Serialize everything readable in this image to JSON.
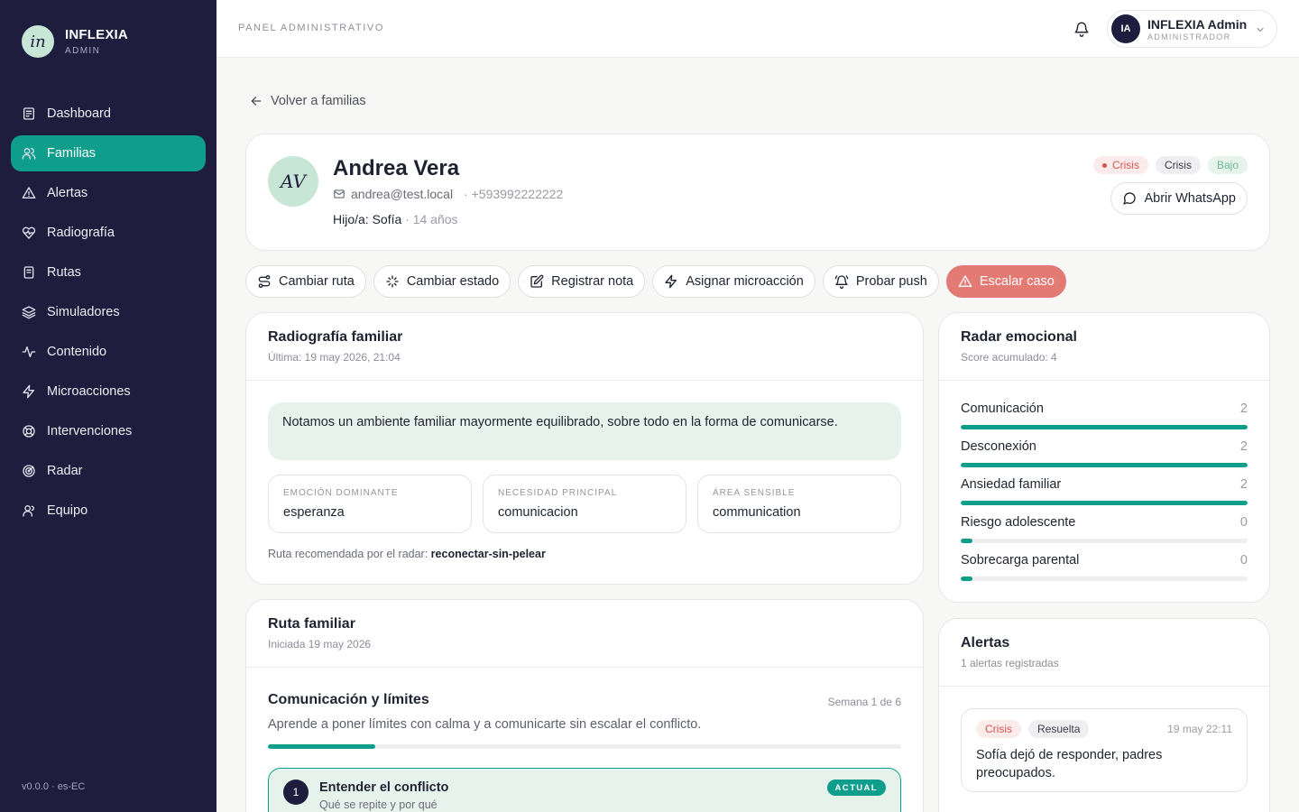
{
  "brand": {
    "logo": "in",
    "name": "INFLEXIA",
    "sub": "ADMIN"
  },
  "sidebar": {
    "items": [
      {
        "label": "Dashboard",
        "icon": "dashboard-icon"
      },
      {
        "label": "Familias",
        "icon": "users-icon",
        "active": true
      },
      {
        "label": "Alertas",
        "icon": "alert-triangle-icon"
      },
      {
        "label": "Radiografía",
        "icon": "heart-pulse-icon"
      },
      {
        "label": "Rutas",
        "icon": "book-icon"
      },
      {
        "label": "Simuladores",
        "icon": "layers-icon"
      },
      {
        "label": "Contenido",
        "icon": "activity-icon"
      },
      {
        "label": "Microacciones",
        "icon": "zap-icon"
      },
      {
        "label": "Intervenciones",
        "icon": "lifebuoy-icon"
      },
      {
        "label": "Radar",
        "icon": "radar-icon"
      },
      {
        "label": "Equipo",
        "icon": "user-group-icon"
      }
    ],
    "version": "v0.0.0 · es-EC"
  },
  "topbar": {
    "title": "PANEL ADMINISTRATIVO",
    "user": {
      "initials": "IA",
      "name": "INFLEXIA Admin",
      "role": "ADMINISTRADOR"
    }
  },
  "back_link": "Volver a familias",
  "profile": {
    "initials": "AV",
    "name": "Andrea Vera",
    "email": "andrea@test.local",
    "phone": "· +593992222222",
    "child_prefix": "Hijo/a:",
    "child_name": "Sofía",
    "child_age": "· 14 años",
    "badges": {
      "status": "Crisis",
      "stage": "Crisis",
      "level": "Bajo"
    },
    "whatsapp_label": "Abrir WhatsApp"
  },
  "actions": {
    "change_route": "Cambiar ruta",
    "change_state": "Cambiar estado",
    "register_note": "Registrar nota",
    "assign_micro": "Asignar microacción",
    "test_push": "Probar push",
    "escalate": "Escalar caso"
  },
  "radiografia": {
    "title": "Radiografía familiar",
    "subtitle": "Última: 19 may 2026, 21:04",
    "summary": "Notamos un ambiente familiar mayormente equilibrado, sobre todo en la forma de comunicarse.",
    "kpis": [
      {
        "label": "EMOCIÓN DOMINANTE",
        "value": "esperanza"
      },
      {
        "label": "NECESIDAD PRINCIPAL",
        "value": "comunicacion"
      },
      {
        "label": "ÁREA SENSIBLE",
        "value": "communication"
      }
    ],
    "recommendation_label": "Ruta recomendada por el radar:",
    "recommendation_value": "reconectar-sin-pelear"
  },
  "radar": {
    "title": "Radar emocional",
    "subtitle": "Score acumulado: 4",
    "rows": [
      {
        "label": "Comunicación",
        "value": "2",
        "fill": 1.0
      },
      {
        "label": "Desconexión",
        "value": "2",
        "fill": 1.0
      },
      {
        "label": "Ansiedad familiar",
        "value": "2",
        "fill": 1.0
      },
      {
        "label": "Riesgo adolescente",
        "value": "0",
        "fill": 0.04
      },
      {
        "label": "Sobrecarga parental",
        "value": "0",
        "fill": 0.04
      }
    ]
  },
  "ruta": {
    "title": "Ruta familiar",
    "subtitle": "Iniciada 19 may 2026",
    "section_title": "Comunicación y límites",
    "week": "Semana 1 de 6",
    "description": "Aprende a poner límites con calma y a comunicarte sin escalar el conflicto.",
    "progress": 0.17,
    "step": {
      "number": "1",
      "title": "Entender el conflicto",
      "subtitle": "Qué se repite y por qué",
      "tag": "ACTUAL"
    }
  },
  "alerts": {
    "title": "Alertas",
    "subtitle": "1 alertas registradas",
    "item": {
      "severity": "Crisis",
      "status": "Resuelta",
      "date": "19 may 22:11",
      "text": "Sofía dejó de responder, padres preocupados."
    }
  },
  "colors": {
    "sidebar": "#1f1d3d",
    "accent": "#0f9e8c",
    "danger": "#e47a74",
    "mint": "#e6f3ec"
  }
}
